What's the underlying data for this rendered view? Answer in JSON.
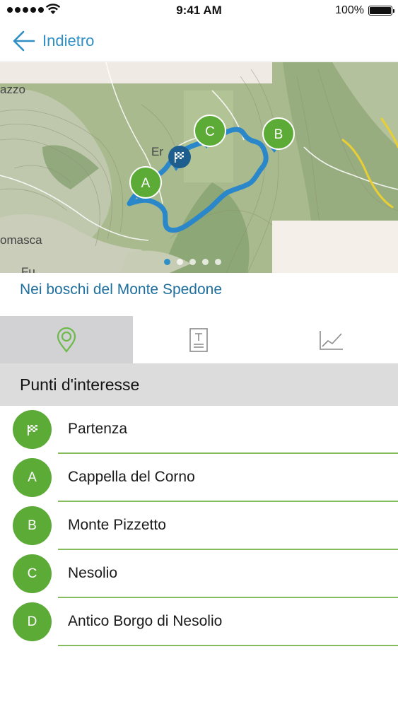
{
  "status_bar": {
    "time": "9:41 AM",
    "battery_percent": "100%",
    "signal_icon": "signal-dots-icon",
    "wifi_icon": "wifi-icon",
    "battery_icon": "battery-icon"
  },
  "nav": {
    "back_label": "Indietro",
    "back_icon": "arrow-left-icon"
  },
  "map": {
    "place_labels": [
      "azzo",
      "Er",
      "omasca",
      "Fu"
    ],
    "markers": [
      {
        "id": "start",
        "label": "",
        "icon": "checkered-flag-icon",
        "color": "#1d5e8f"
      },
      {
        "id": "A",
        "label": "A",
        "color": "#5cab37"
      },
      {
        "id": "B",
        "label": "B",
        "color": "#5cab37"
      },
      {
        "id": "C",
        "label": "C",
        "color": "#5cab37"
      }
    ],
    "pager_count": 5,
    "pager_active": 0,
    "route_color": "#2a87c9"
  },
  "route": {
    "title": "Nei boschi del Monte Spedone"
  },
  "tabs": [
    {
      "id": "poi",
      "icon": "map-pin-icon",
      "active": true
    },
    {
      "id": "description",
      "icon": "text-document-icon",
      "active": false
    },
    {
      "id": "elevation",
      "icon": "line-chart-icon",
      "active": false
    }
  ],
  "section": {
    "title": "Punti d'interesse"
  },
  "poi": [
    {
      "badge": "",
      "icon": "checkered-flag-icon",
      "label": "Partenza"
    },
    {
      "badge": "A",
      "label": "Cappella del Corno"
    },
    {
      "badge": "B",
      "label": "Monte Pizzetto"
    },
    {
      "badge": "C",
      "label": "Nesolio"
    },
    {
      "badge": "D",
      "label": "Antico Borgo di Nesolio"
    }
  ],
  "colors": {
    "accent": "#2f8fc4",
    "title_blue": "#1f6f9e",
    "badge_green": "#5cab37",
    "divider_green": "#84bd5f",
    "active_tab": "#d2d2d4",
    "section_bg": "#dcdcdd"
  }
}
